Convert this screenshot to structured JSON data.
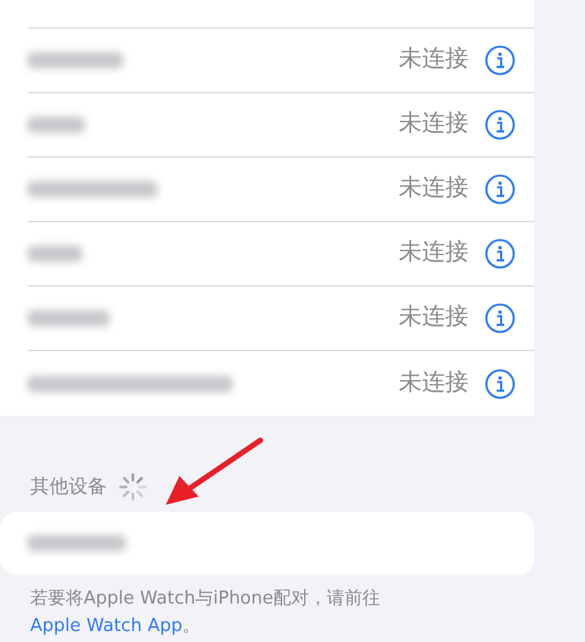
{
  "my_devices": [
    {
      "status": "未连接"
    },
    {
      "status": "未连接"
    },
    {
      "status": "未连接"
    },
    {
      "status": "未连接"
    },
    {
      "status": "未连接"
    },
    {
      "status": "未连接"
    }
  ],
  "other_devices": {
    "header": "其他设备",
    "loading": true,
    "devices": [
      {
        "kind": "blurred"
      }
    ]
  },
  "footer": {
    "text": "若要将Apple Watch与iPhone配对，请前往",
    "link": "Apple Watch App",
    "end": "。"
  },
  "annotation": {
    "kind": "arrow"
  }
}
